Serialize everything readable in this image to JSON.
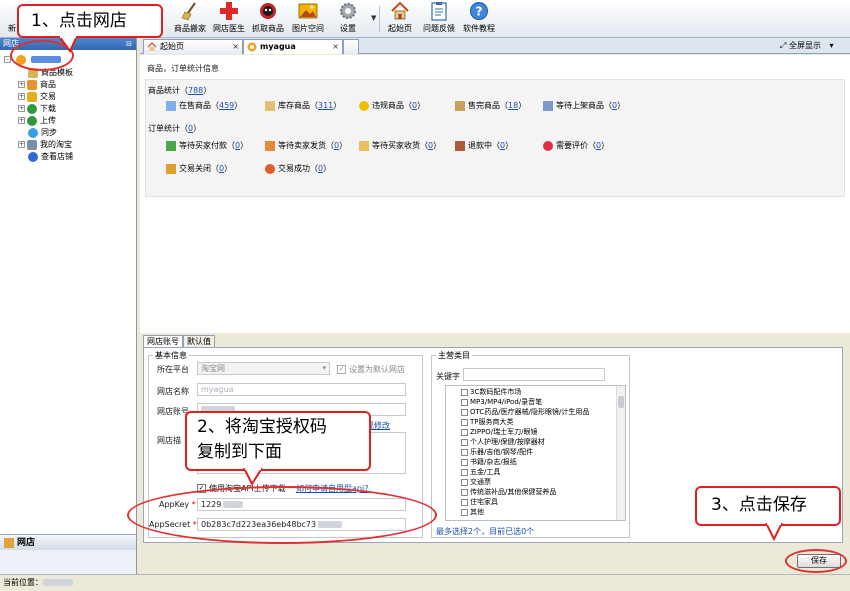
{
  "toolbar": {
    "new_label": "新",
    "buttons": [
      {
        "label": "商品搬家",
        "icon": "broom-icon"
      },
      {
        "label": "网店医生",
        "icon": "medical-cross-icon"
      },
      {
        "label": "抓取商品",
        "icon": "spider-icon"
      },
      {
        "label": "图片空间",
        "icon": "image-icon"
      },
      {
        "label": "设置",
        "icon": "gear-icon"
      },
      {
        "label": "起始页",
        "icon": "home-icon"
      },
      {
        "label": "问题反馈",
        "icon": "clipboard-icon"
      },
      {
        "label": "软件教程",
        "icon": "help-icon"
      }
    ]
  },
  "sidebar": {
    "header": "网店",
    "items": [
      {
        "label": "商品模板",
        "level": 2,
        "toggle": ""
      },
      {
        "label": "商品",
        "level": 2,
        "toggle": "+"
      },
      {
        "label": "交易",
        "level": 2,
        "toggle": "+"
      },
      {
        "label": "下载",
        "level": 2,
        "toggle": "+"
      },
      {
        "label": "上传",
        "level": 2,
        "toggle": "+"
      },
      {
        "label": "同步",
        "level": 2,
        "toggle": ""
      },
      {
        "label": "我的淘宝",
        "level": 2,
        "toggle": "+"
      },
      {
        "label": "查看店铺",
        "level": 2,
        "toggle": ""
      }
    ],
    "bottom_label": "网店"
  },
  "tabs": [
    {
      "label": "起始页"
    },
    {
      "label": "myagua"
    }
  ],
  "fullscreen_label": "全屏显示",
  "stats": {
    "section_title": "商品，订单统计信息",
    "product_title": "商品统计",
    "product_total": "788",
    "product_items": [
      {
        "label": "在售商品",
        "count": "459"
      },
      {
        "label": "库存商品",
        "count": "311"
      },
      {
        "label": "违规商品",
        "count": "0"
      },
      {
        "label": "售完商品",
        "count": "18"
      },
      {
        "label": "等待上架商品",
        "count": "0"
      }
    ],
    "order_title": "订单统计",
    "order_total": "0",
    "order_items": [
      {
        "label": "等待买家付款",
        "count": "0"
      },
      {
        "label": "等待卖家发货",
        "count": "0"
      },
      {
        "label": "等待买家收货",
        "count": "0"
      },
      {
        "label": "退款中",
        "count": "0"
      },
      {
        "label": "需要评价",
        "count": "0"
      },
      {
        "label": "交易关闭",
        "count": "0"
      },
      {
        "label": "交易成功",
        "count": "0"
      }
    ]
  },
  "form": {
    "tabs": [
      "网店账号",
      "默认值"
    ],
    "basic_legend": "基本信息",
    "platform_label": "所在平台",
    "platform_value": "淘宝网",
    "default_shop_label": "设置为默认网店",
    "shop_name_label": "网店名称",
    "shop_name_value": "myagua",
    "shop_account_label": "网店账号",
    "shop_desc_label": "网店描",
    "modify_link": "现修改",
    "use_api_label": "使用淘宝API上传下载",
    "apply_api_link": "如何申请自用型api?",
    "appkey_label": "AppKey",
    "appkey_value": "1229",
    "appsecret_label": "AppSecret",
    "appsecret_value": "0b283c7d223ea36eb48bc73",
    "category_legend": "主营类目",
    "keyword_label": "关键字",
    "categories": [
      "3C数码配件市场",
      "MP3/MP4/iPod/录音笔",
      "OTC药品/医疗器械/隐形眼镜/计生用品",
      "TP服务商大类",
      "ZIPPO/瑞士军刀/眼镜",
      "个人护理/保健/按摩器材",
      "乐器/吉他/钢琴/配件",
      "书籍/杂志/报纸",
      "五金/工具",
      "交通票",
      "传统滋补品/其他保健营养品",
      "住宅家具",
      "其他"
    ],
    "category_hint": "最多选择2个，目前已选0个",
    "save_label": "保存"
  },
  "status_bar": {
    "label": "当前位置："
  },
  "annotations": {
    "step1": "1、点击网店",
    "step2_line1": "2、将淘宝授权码",
    "step2_line2": "复制到下面",
    "step3": "3、点击保存"
  }
}
